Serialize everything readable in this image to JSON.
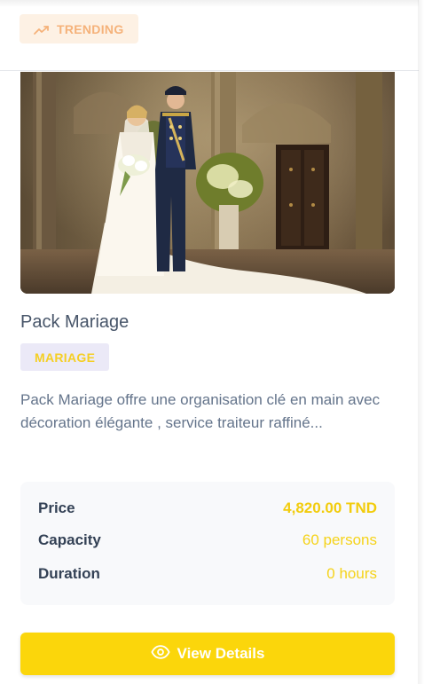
{
  "header": {
    "badge_label": "TRENDING",
    "badge_icon": "trending-up-icon"
  },
  "package": {
    "image_alt": "Wedding couple in palace hall",
    "title": "Pack Mariage",
    "category": "MARIAGE",
    "description": "Pack Mariage offre une organisation clé en main avec décoration élégante , service traiteur raffiné..."
  },
  "stats": {
    "price_label": "Price",
    "price_value": "4,820.00 TND",
    "capacity_label": "Capacity",
    "capacity_value": "60 persons",
    "duration_label": "Duration",
    "duration_value": "0 hours"
  },
  "actions": {
    "view_details_label": "View Details",
    "view_details_icon": "eye-icon"
  },
  "colors": {
    "accent": "#fbd60b",
    "badge_bg": "#fdf1e4",
    "badge_text": "#f5b27a",
    "category_bg": "#ebe9f7"
  }
}
